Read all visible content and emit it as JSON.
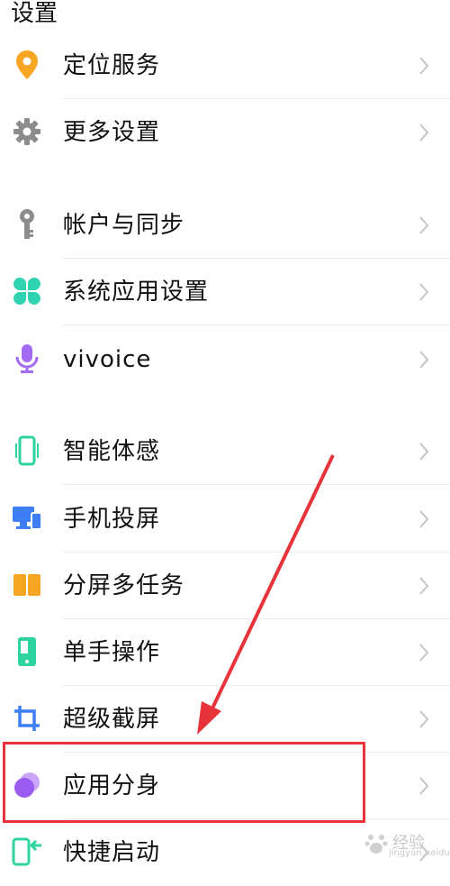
{
  "header": {
    "title": "设置"
  },
  "items": [
    {
      "label": "定位服务",
      "icon": "location-pin-icon",
      "color": "#f6a623"
    },
    {
      "label": "更多设置",
      "icon": "gear-icon",
      "color": "#8c8c8c"
    },
    {
      "label": "帐户与同步",
      "icon": "key-icon",
      "color": "#8c8c8c"
    },
    {
      "label": "系统应用设置",
      "icon": "four-petal-icon",
      "color": "#2ed3b1"
    },
    {
      "label": "vivoice",
      "icon": "microphone-icon",
      "color": "#a26bf2"
    },
    {
      "label": "智能体感",
      "icon": "phone-motion-icon",
      "color": "#2ed3a0"
    },
    {
      "label": "手机投屏",
      "icon": "screen-cast-icon",
      "color": "#3d7df5"
    },
    {
      "label": "分屏多任务",
      "icon": "split-screen-icon",
      "color": "#f6a623"
    },
    {
      "label": "单手操作",
      "icon": "one-hand-icon",
      "color": "#2ed3a0"
    },
    {
      "label": "超级截屏",
      "icon": "crop-icon",
      "color": "#3d7df5"
    },
    {
      "label": "应用分身",
      "icon": "app-clone-icon",
      "color": "#a76cf2"
    },
    {
      "label": "快捷启动",
      "icon": "quick-launch-icon",
      "color": "#2ed3a0"
    }
  ],
  "annotation": {
    "color": "#e8333a"
  },
  "watermark": {
    "text": "经验",
    "sub": "jingyan.baidu.com"
  }
}
